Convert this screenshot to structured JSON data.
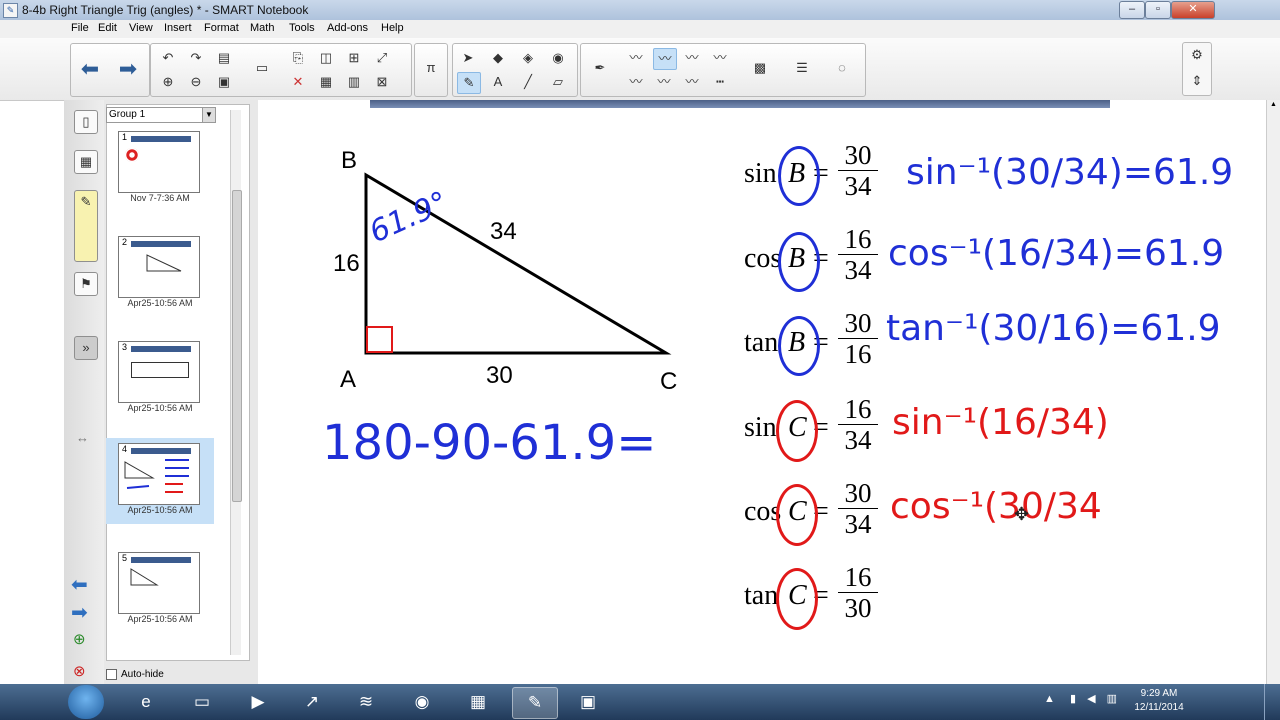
{
  "window": {
    "title": "8-4b Right Triangle Trig (angles) * - SMART Notebook",
    "icon": "notebook-icon",
    "controls": [
      "minimize",
      "maximize",
      "close"
    ]
  },
  "menu": [
    "File",
    "Edit",
    "View",
    "Insert",
    "Format",
    "Math",
    "Tools",
    "Add-ons",
    "Help"
  ],
  "sidebar": {
    "group": "Group 1",
    "pages": [
      {
        "num": "1",
        "label": "Nov 7-7:36 AM"
      },
      {
        "num": "2",
        "label": "Apr25-10:56 AM"
      },
      {
        "num": "3",
        "label": "Apr25-10:56 AM"
      },
      {
        "num": "4",
        "label": "Apr25-10:56 AM"
      },
      {
        "num": "5",
        "label": "Apr25-10:56 AM"
      }
    ],
    "selected_page": "4",
    "autohide": "Auto-hide"
  },
  "triangle": {
    "vertices": [
      "A",
      "B",
      "C"
    ],
    "sides": {
      "AB": "16",
      "AC": "30",
      "BC": "34"
    },
    "angle_B_ink": "61.9°"
  },
  "work": {
    "left_ink": "180-90-61.9="
  },
  "equations": [
    {
      "func": "sin",
      "angle": "B",
      "num": "30",
      "den": "34",
      "ink": "sin⁻¹(30/34)=61.9",
      "ink_color": "blue"
    },
    {
      "func": "cos",
      "angle": "B",
      "num": "16",
      "den": "34",
      "ink": "cos⁻¹(16/34)=61.9",
      "ink_color": "blue"
    },
    {
      "func": "tan",
      "angle": "B",
      "num": "30",
      "den": "16",
      "ink": "tan⁻¹(30/16)=61.9",
      "ink_color": "blue"
    },
    {
      "func": "sin",
      "angle": "C",
      "num": "16",
      "den": "34",
      "ink": "sin⁻¹(16/34)",
      "ink_color": "red"
    },
    {
      "func": "cos",
      "angle": "C",
      "num": "30",
      "den": "34",
      "ink": "cos⁻¹(30/34",
      "ink_color": "red"
    },
    {
      "func": "tan",
      "angle": "C",
      "num": "16",
      "den": "30",
      "ink": "",
      "ink_color": "red"
    }
  ],
  "taskbar": {
    "clock_time": "9:29 AM",
    "clock_date": "12/11/2014"
  },
  "colors": {
    "ink_blue": "#1f2fd6",
    "ink_red": "#e11919",
    "selected_thumb": "#c6e0f7"
  }
}
